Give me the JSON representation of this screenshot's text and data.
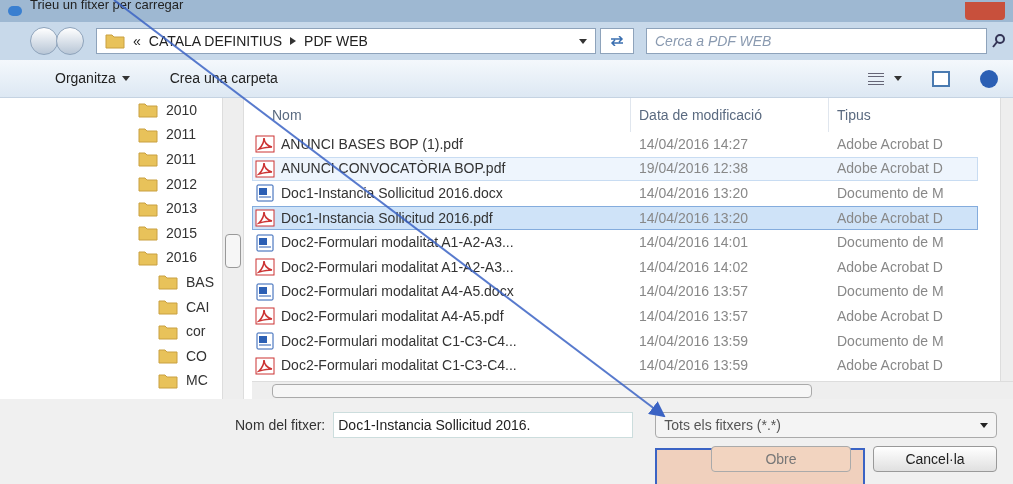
{
  "window": {
    "title": "Trieu un fitxer per carregar"
  },
  "address": {
    "overflow": "«",
    "path": [
      "CATALA DEFINITIUS",
      "PDF WEB"
    ],
    "search_placeholder": "Cerca a PDF WEB"
  },
  "toolbar": {
    "organize": "Organitza",
    "new_folder": "Crea una carpeta"
  },
  "tree": [
    {
      "label": "2010"
    },
    {
      "label": "2011"
    },
    {
      "label": "2011"
    },
    {
      "label": "2012"
    },
    {
      "label": "2013"
    },
    {
      "label": "2015"
    },
    {
      "label": "2016",
      "children": [
        {
          "label": "BAS"
        },
        {
          "label": "CAI"
        },
        {
          "label": "cor"
        },
        {
          "label": "CO"
        },
        {
          "label": "MC"
        }
      ]
    }
  ],
  "table": {
    "columns": [
      "Nom",
      "Data de modificació",
      "Tipus"
    ],
    "rows": [
      {
        "kind": "pdf",
        "name": "ANUNCI BASES BOP (1).pdf",
        "date": "14/04/2016 14:27",
        "type": "Adobe Acrobat D",
        "selected": false,
        "hovered": false
      },
      {
        "kind": "pdf",
        "name": "ANUNCI CONVOCATÒRIA BOP.pdf",
        "date": "19/04/2016 12:38",
        "type": "Adobe Acrobat D",
        "selected": false,
        "hovered": true
      },
      {
        "kind": "docx",
        "name": "Doc1-Instancia Sollicitud 2016.docx",
        "date": "14/04/2016 13:20",
        "type": "Documento de M",
        "selected": false,
        "hovered": false
      },
      {
        "kind": "pdf",
        "name": "Doc1-Instancia Sollicitud 2016.pdf",
        "date": "14/04/2016 13:20",
        "type": "Adobe Acrobat D",
        "selected": true,
        "hovered": false
      },
      {
        "kind": "docx",
        "name": "Doc2-Formulari modalitat A1-A2-A3...",
        "date": "14/04/2016 14:01",
        "type": "Documento de M",
        "selected": false,
        "hovered": false
      },
      {
        "kind": "pdf",
        "name": "Doc2-Formulari modalitat A1-A2-A3...",
        "date": "14/04/2016 14:02",
        "type": "Adobe Acrobat D",
        "selected": false,
        "hovered": false
      },
      {
        "kind": "docx",
        "name": "Doc2-Formulari modalitat A4-A5.docx",
        "date": "14/04/2016 13:57",
        "type": "Documento de M",
        "selected": false,
        "hovered": false
      },
      {
        "kind": "pdf",
        "name": "Doc2-Formulari modalitat A4-A5.pdf",
        "date": "14/04/2016 13:57",
        "type": "Adobe Acrobat D",
        "selected": false,
        "hovered": false
      },
      {
        "kind": "docx",
        "name": "Doc2-Formulari modalitat C1-C3-C4...",
        "date": "14/04/2016 13:59",
        "type": "Documento de M",
        "selected": false,
        "hovered": false
      },
      {
        "kind": "pdf",
        "name": "Doc2-Formulari modalitat C1-C3-C4...",
        "date": "14/04/2016 13:59",
        "type": "Adobe Acrobat D",
        "selected": false,
        "hovered": false
      }
    ]
  },
  "footer": {
    "filename_label": "Nom del fitxer:",
    "filename_value": "Doc1-Instancia Sollicitud 2016.",
    "filter": "Tots els fitxers (*.*)",
    "open": "Obre",
    "cancel": "Cancel·la"
  }
}
